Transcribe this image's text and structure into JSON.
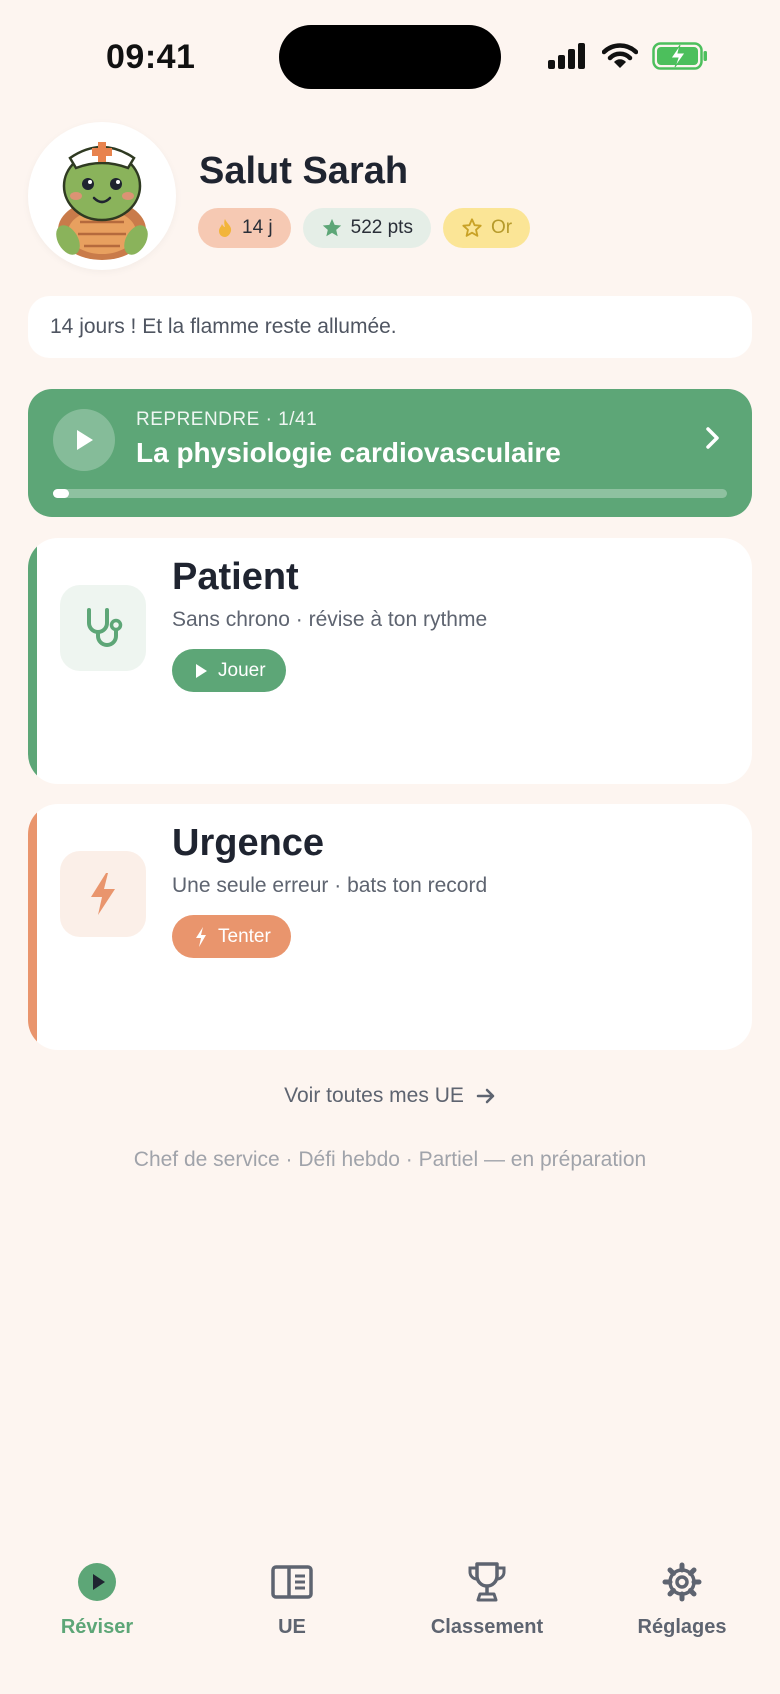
{
  "status_bar": {
    "time": "09:41"
  },
  "header": {
    "greeting": "Salut Sarah",
    "chips": {
      "streak": "14 j",
      "points": "522 pts",
      "level": "Or"
    }
  },
  "message": "14 jours ! Et la flamme reste allumée.",
  "resume": {
    "kicker": "REPRENDRE · 1/41",
    "title": "La physiologie cardiovasculaire",
    "progress": 0.024
  },
  "modes": {
    "patient": {
      "title": "Patient",
      "subtitle": "Sans chrono · révise à ton rythme",
      "button": "Jouer",
      "icon": "stethoscope-icon"
    },
    "urgence": {
      "title": "Urgence",
      "subtitle": "Une seule erreur · bats ton record",
      "button": "Tenter",
      "icon": "lightning-icon"
    }
  },
  "all_ue_link": "Voir toutes mes UE",
  "upcoming": "Chef de service · Défi hebdo · Partiel — en préparation",
  "tabs": [
    {
      "label": "Réviser",
      "icon": "play-circle-icon",
      "active": true
    },
    {
      "label": "UE",
      "icon": "book-icon",
      "active": false
    },
    {
      "label": "Classement",
      "icon": "trophy-icon",
      "active": false
    },
    {
      "label": "Réglages",
      "icon": "gear-icon",
      "active": false
    }
  ],
  "colors": {
    "green": "#5DA677",
    "orange": "#E9956D",
    "background": "#FDF5F0",
    "gold_chip": "#FBE596"
  }
}
